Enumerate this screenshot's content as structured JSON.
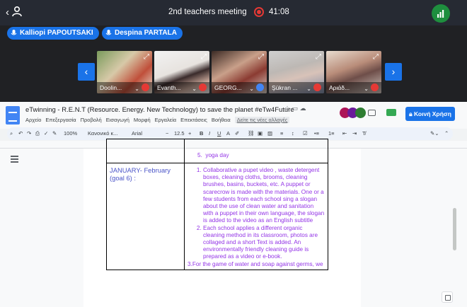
{
  "meeting": {
    "title": "2nd teachers meeting",
    "time": "41:08",
    "colors": {
      "record": "#e53935",
      "accent": "#1a73e8",
      "signal": "#1e8e3e"
    }
  },
  "chips": [
    {
      "name": "Kalliopi PAPOUTSAKI"
    },
    {
      "name": "Despina PARTALA"
    }
  ],
  "video_tiles": [
    {
      "name": "Doolin...",
      "muted": true
    },
    {
      "name": "Evanth...",
      "muted": true
    },
    {
      "name": "GEORG...",
      "muted": false
    },
    {
      "name": "Şükran ...",
      "muted": true
    },
    {
      "name": "Αριάδ...",
      "muted": true
    }
  ],
  "docs": {
    "title": "eTwinning - R.E.N.T (Resource. Energy. New Technology) to save the planet #eTw4Future",
    "menu": [
      "Αρχείο",
      "Επεξεργασία",
      "Προβολή",
      "Εισαγωγή",
      "Μορφή",
      "Εργαλεία",
      "Επεκτάσεις",
      "Βοήθεια"
    ],
    "changes_link": "Δείτε τις νέες αλλαγές",
    "share_label": "Κοινή Χρήση",
    "toolbar": {
      "zoom": "100%",
      "style": "Κανονικό κ...",
      "font": "Arial",
      "size": "12.5",
      "bold": "B",
      "italic": "I",
      "underline": "U",
      "text_color": "A"
    }
  },
  "table": {
    "prev_item_num": "5.",
    "prev_item": "yoga day",
    "label": "JANUARY- February (goal 6) :",
    "activities": [
      "Collaborative a pupet video , waste detergent boxes, cleaning cloths, brooms, cleaning brushes, basins, buckets, etc. A puppet or scarecrow is made with the materials. One or a few students from each school sing a slogan about the use of clean water and sanitation with a puppet in their own language, the slogan is added to the video as an English subtitle",
      "Each school applies a different organic cleaning method in its classroom, photos are collaged and a short Text is added. An environmentally friendly cleaning guide is prepared as a video or e-book."
    ],
    "game_line": "3.For the game of water and soap against germs, we"
  }
}
